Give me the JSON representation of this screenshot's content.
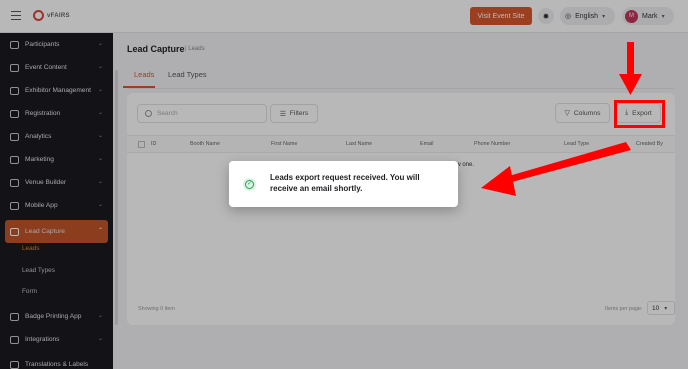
{
  "app": {
    "logo_text": "vFAIRS"
  },
  "topbar": {
    "visit_label": "Visit Event Site",
    "language": "English",
    "user_initial": "M",
    "user_name": "Mark"
  },
  "sidebar": {
    "items": [
      {
        "label": "Participants"
      },
      {
        "label": "Event Content"
      },
      {
        "label": "Exhibitor Management"
      },
      {
        "label": "Registration"
      },
      {
        "label": "Analytics"
      },
      {
        "label": "Marketing"
      },
      {
        "label": "Venue Builder"
      },
      {
        "label": "Mobile App"
      },
      {
        "label": "Lead Capture"
      },
      {
        "label": "Badge Printing App"
      },
      {
        "label": "Integrations"
      },
      {
        "label": "Translations & Labels"
      }
    ],
    "subitems": [
      {
        "label": "Leads"
      },
      {
        "label": "Lead Types"
      },
      {
        "label": "Form"
      }
    ]
  },
  "page": {
    "title": "Lead Capture",
    "crumb": "Leads",
    "tabs": [
      {
        "label": "Leads"
      },
      {
        "label": "Lead Types"
      }
    ]
  },
  "toolbar": {
    "search_placeholder": "Search",
    "filters_label": "Filters",
    "columns_label": "Columns",
    "export_label": "Export"
  },
  "table": {
    "columns": [
      "ID",
      "Booth Name",
      "First Name",
      "Last Name",
      "Email",
      "Phone Number",
      "Lead Type",
      "Created By"
    ],
    "empty_fragment": "ew one.",
    "showing": "Showing 0 item",
    "items_per_page_label": "Items per page:",
    "items_per_page": "10"
  },
  "toast": {
    "message": "Leads export request received. You will receive an email shortly."
  },
  "colors": {
    "accent": "#d9582f",
    "annotation": "#ff0000",
    "success": "#2e9e5a"
  }
}
